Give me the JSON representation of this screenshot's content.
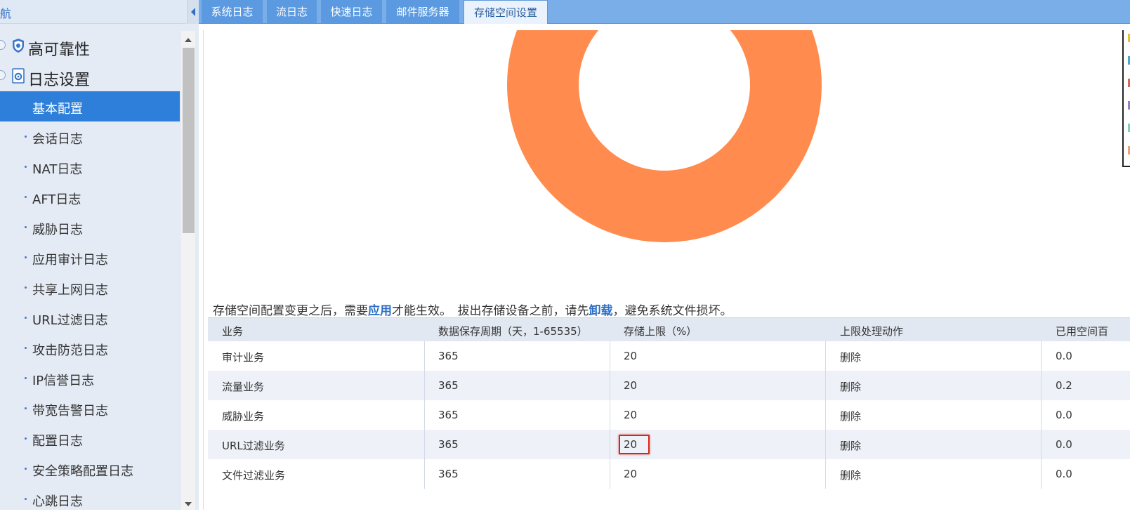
{
  "nav": {
    "title": "航",
    "groups": [
      {
        "label": "高可靠性",
        "icon": "shield-icon"
      },
      {
        "label": "日志设置",
        "icon": "log-settings-icon"
      }
    ],
    "items": [
      "基本配置",
      "会话日志",
      "NAT日志",
      "AFT日志",
      "威胁日志",
      "应用审计日志",
      "共享上网日志",
      "URL过滤日志",
      "攻击防范日志",
      "IP信誉日志",
      "带宽告警日志",
      "配置日志",
      "安全策略配置日志",
      "心跳日志"
    ],
    "active_item": "基本配置"
  },
  "tabs": [
    "系统日志",
    "流日志",
    "快速日志",
    "邮件服务器",
    "存储空间设置"
  ],
  "active_tab": "存储空间设置",
  "colors": {
    "donut": "#ff8c4e",
    "legend": [
      "#e8c040",
      "#4aa8c8",
      "#d9665b",
      "#9a7cc8",
      "#7fd3b4",
      "#f0a07a"
    ],
    "highlight": "#d9231b"
  },
  "notice": {
    "part1": "存储空间配置变更之后，需要",
    "link1": "应用",
    "part2": "才能生效。　拔出存储设备之前，请先",
    "link2": "卸载",
    "part3": "，避免系统文件损坏。"
  },
  "table": {
    "headers": [
      "业务",
      "数据保存周期（天，1-65535）",
      "存储上限（%）",
      "上限处理动作",
      "已用空间百"
    ],
    "rows": [
      [
        "审计业务",
        "365",
        "20",
        "删除",
        "0.0"
      ],
      [
        "流量业务",
        "365",
        "20",
        "删除",
        "0.2"
      ],
      [
        "威胁业务",
        "365",
        "20",
        "删除",
        "0.0"
      ],
      [
        "URL过滤业务",
        "365",
        "20",
        "删除",
        "0.0"
      ],
      [
        "文件过滤业务",
        "365",
        "20",
        "删除",
        "0.0"
      ]
    ],
    "highlighted_cell": "URL过滤业务 存储上限"
  }
}
